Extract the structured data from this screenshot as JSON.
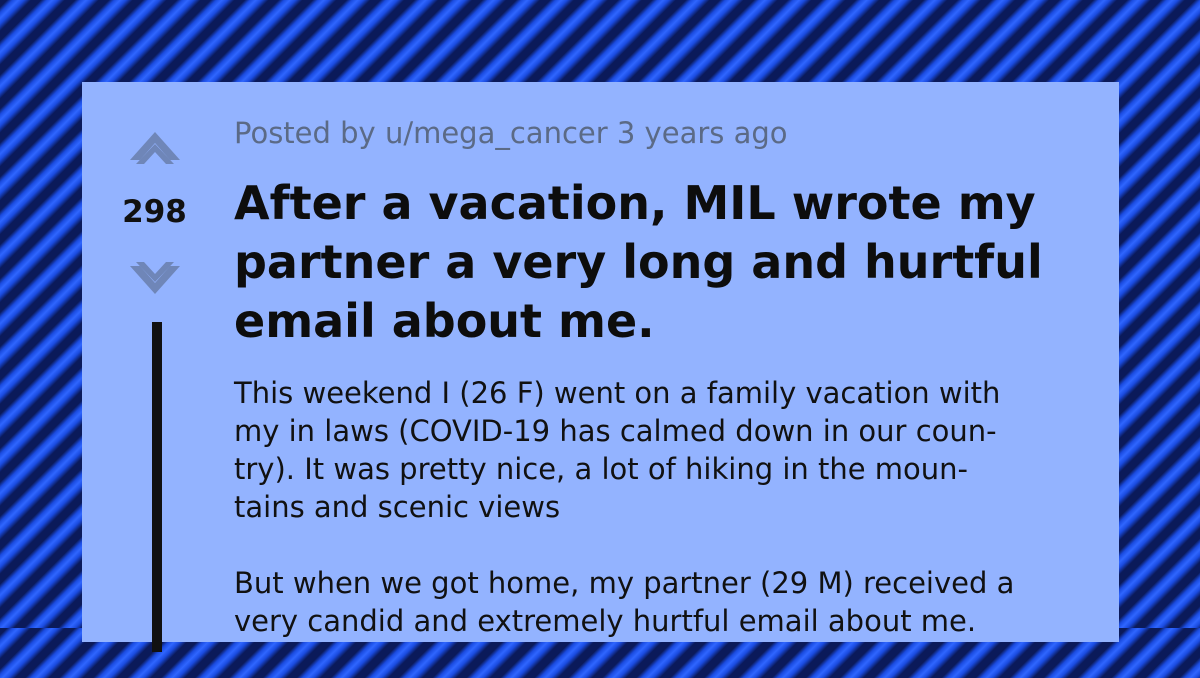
{
  "post": {
    "score": "298",
    "posted_by_prefix": "Posted by",
    "author": "u/mega_cancer",
    "age": "3 years ago",
    "title": "After a vacation, MIL wrote my partner a very long and hurtful email about me.",
    "paragraphs": [
      "This weekend I (26 F) went on a family vacation with my in laws (COVID-19 has calmed down in our coun-\ntry). It was pretty nice, a lot of hiking in the moun-\ntains and scenic views",
      "But when we got home, my partner (29 M) received a very candid and extremely hurtful email about me."
    ]
  },
  "icons": {
    "upvote": "upvote-arrow-icon",
    "downvote": "downvote-arrow-icon"
  },
  "colors": {
    "card_background": "#93b3ff",
    "meta_text": "#5b6a86",
    "arrow": "#6f86b8",
    "thread_line": "#111111"
  }
}
